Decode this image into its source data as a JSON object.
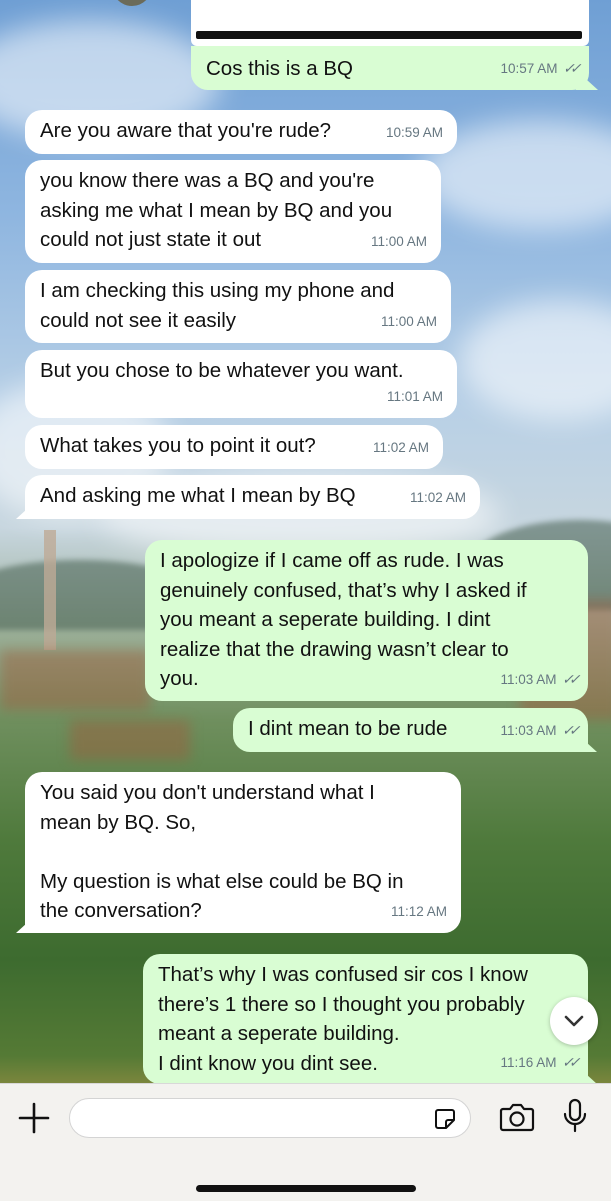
{
  "chat": {
    "quoted_top": {},
    "messages": [
      {
        "text": "Cos this is a BQ",
        "time": "10:57 AM",
        "ticks": "✓✓"
      },
      {
        "text": "Are you aware that you're rude?",
        "time": "10:59 AM"
      },
      {
        "text": "you know there was a BQ and you're\nasking me what I mean by BQ and you\ncould not just state it out",
        "time": "11:00 AM"
      },
      {
        "text": "I am checking this using my phone and\ncould not see it easily",
        "time": "11:00 AM"
      },
      {
        "text": "But you chose to be whatever you want.",
        "time": "11:01 AM"
      },
      {
        "text": "What takes you to point it out?",
        "time": "11:02 AM"
      },
      {
        "text": "And asking me what I mean by BQ",
        "time": "11:02 AM"
      },
      {
        "text": "I apologize if I came off as rude. I was\ngenuinely confused, that’s why I asked if\nyou meant a seperate building. I dint\nrealize that the drawing wasn’t clear to\nyou.",
        "time": "11:03 AM",
        "ticks": "✓✓"
      },
      {
        "text": "I dint mean to be rude",
        "time": "11:03 AM",
        "ticks": "✓✓"
      },
      {
        "text": "You said you don't understand what I\nmean by BQ. So,\n\nMy question is what else could be BQ in\nthe conversation?",
        "time": "11:12 AM"
      },
      {
        "text": "That’s why I was confused sir cos I know\nthere’s 1 there so I thought you probably\nmeant a seperate building.\nI dint know you dint see.",
        "time": "11:16 AM",
        "ticks": "✓✓"
      }
    ]
  },
  "icons": {
    "scroll_down": "chevron-down-icon",
    "attach": "plus-icon",
    "sticker": "sticker-icon",
    "camera": "camera-icon",
    "mic": "microphone-icon"
  },
  "colors": {
    "outgoing_bubble": "#d9fdd3",
    "incoming_bubble": "#ffffff",
    "meta_text": "#667781"
  }
}
